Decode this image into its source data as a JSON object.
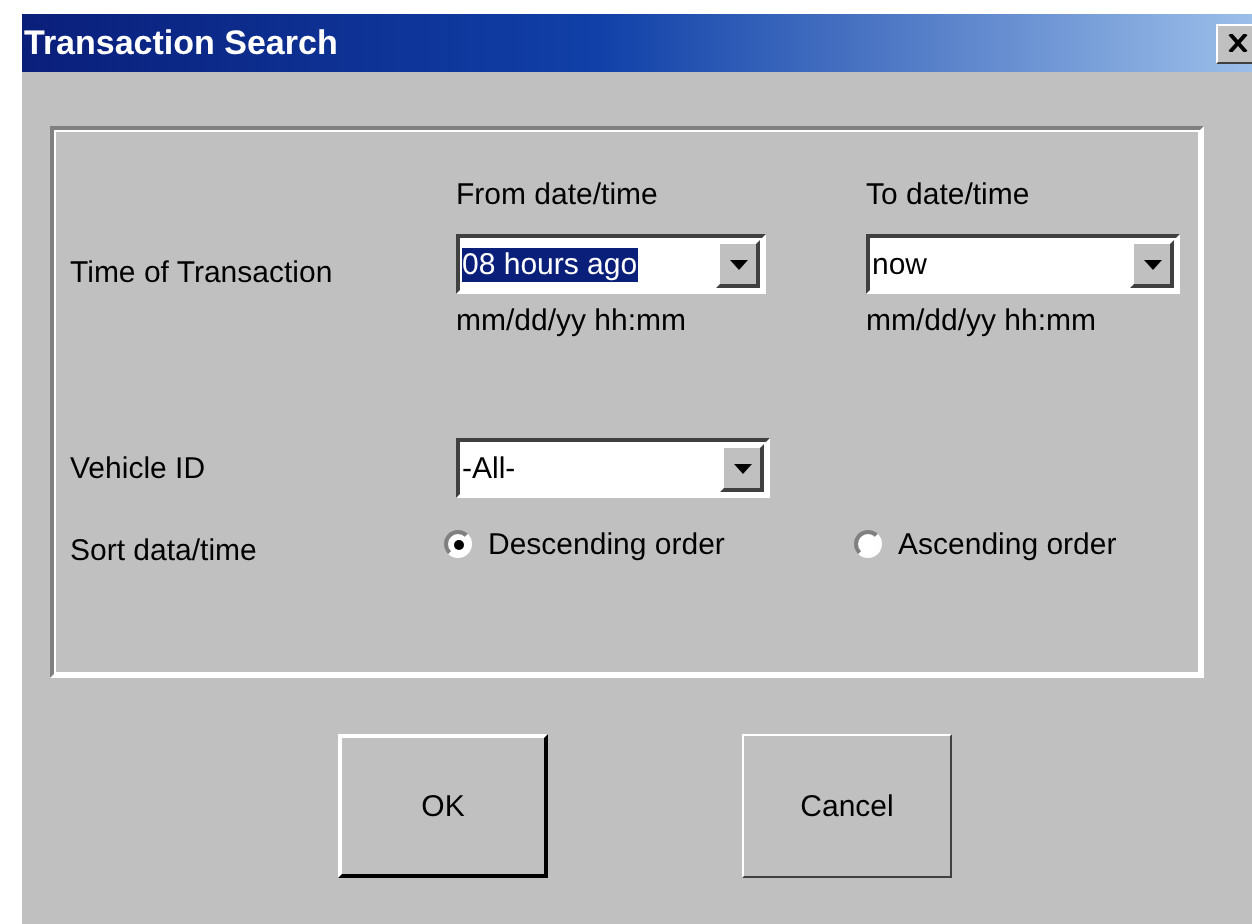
{
  "window": {
    "title": "Transaction Search"
  },
  "time_of_transaction": {
    "label": "Time of Transaction",
    "from": {
      "heading": "From date/time",
      "value": "08 hours ago",
      "highlighted": true,
      "hint": "mm/dd/yy hh:mm"
    },
    "to": {
      "heading": "To date/time",
      "value": "now",
      "highlighted": false,
      "hint": "mm/dd/yy hh:mm"
    }
  },
  "vehicle_id": {
    "label": "Vehicle ID",
    "value": "-All-"
  },
  "sort": {
    "label": "Sort data/time",
    "options": [
      {
        "label": "Descending order",
        "selected": true
      },
      {
        "label": "Ascending order",
        "selected": false
      }
    ]
  },
  "buttons": [
    {
      "label": "OK",
      "default": true
    },
    {
      "label": "Cancel",
      "default": false
    }
  ]
}
